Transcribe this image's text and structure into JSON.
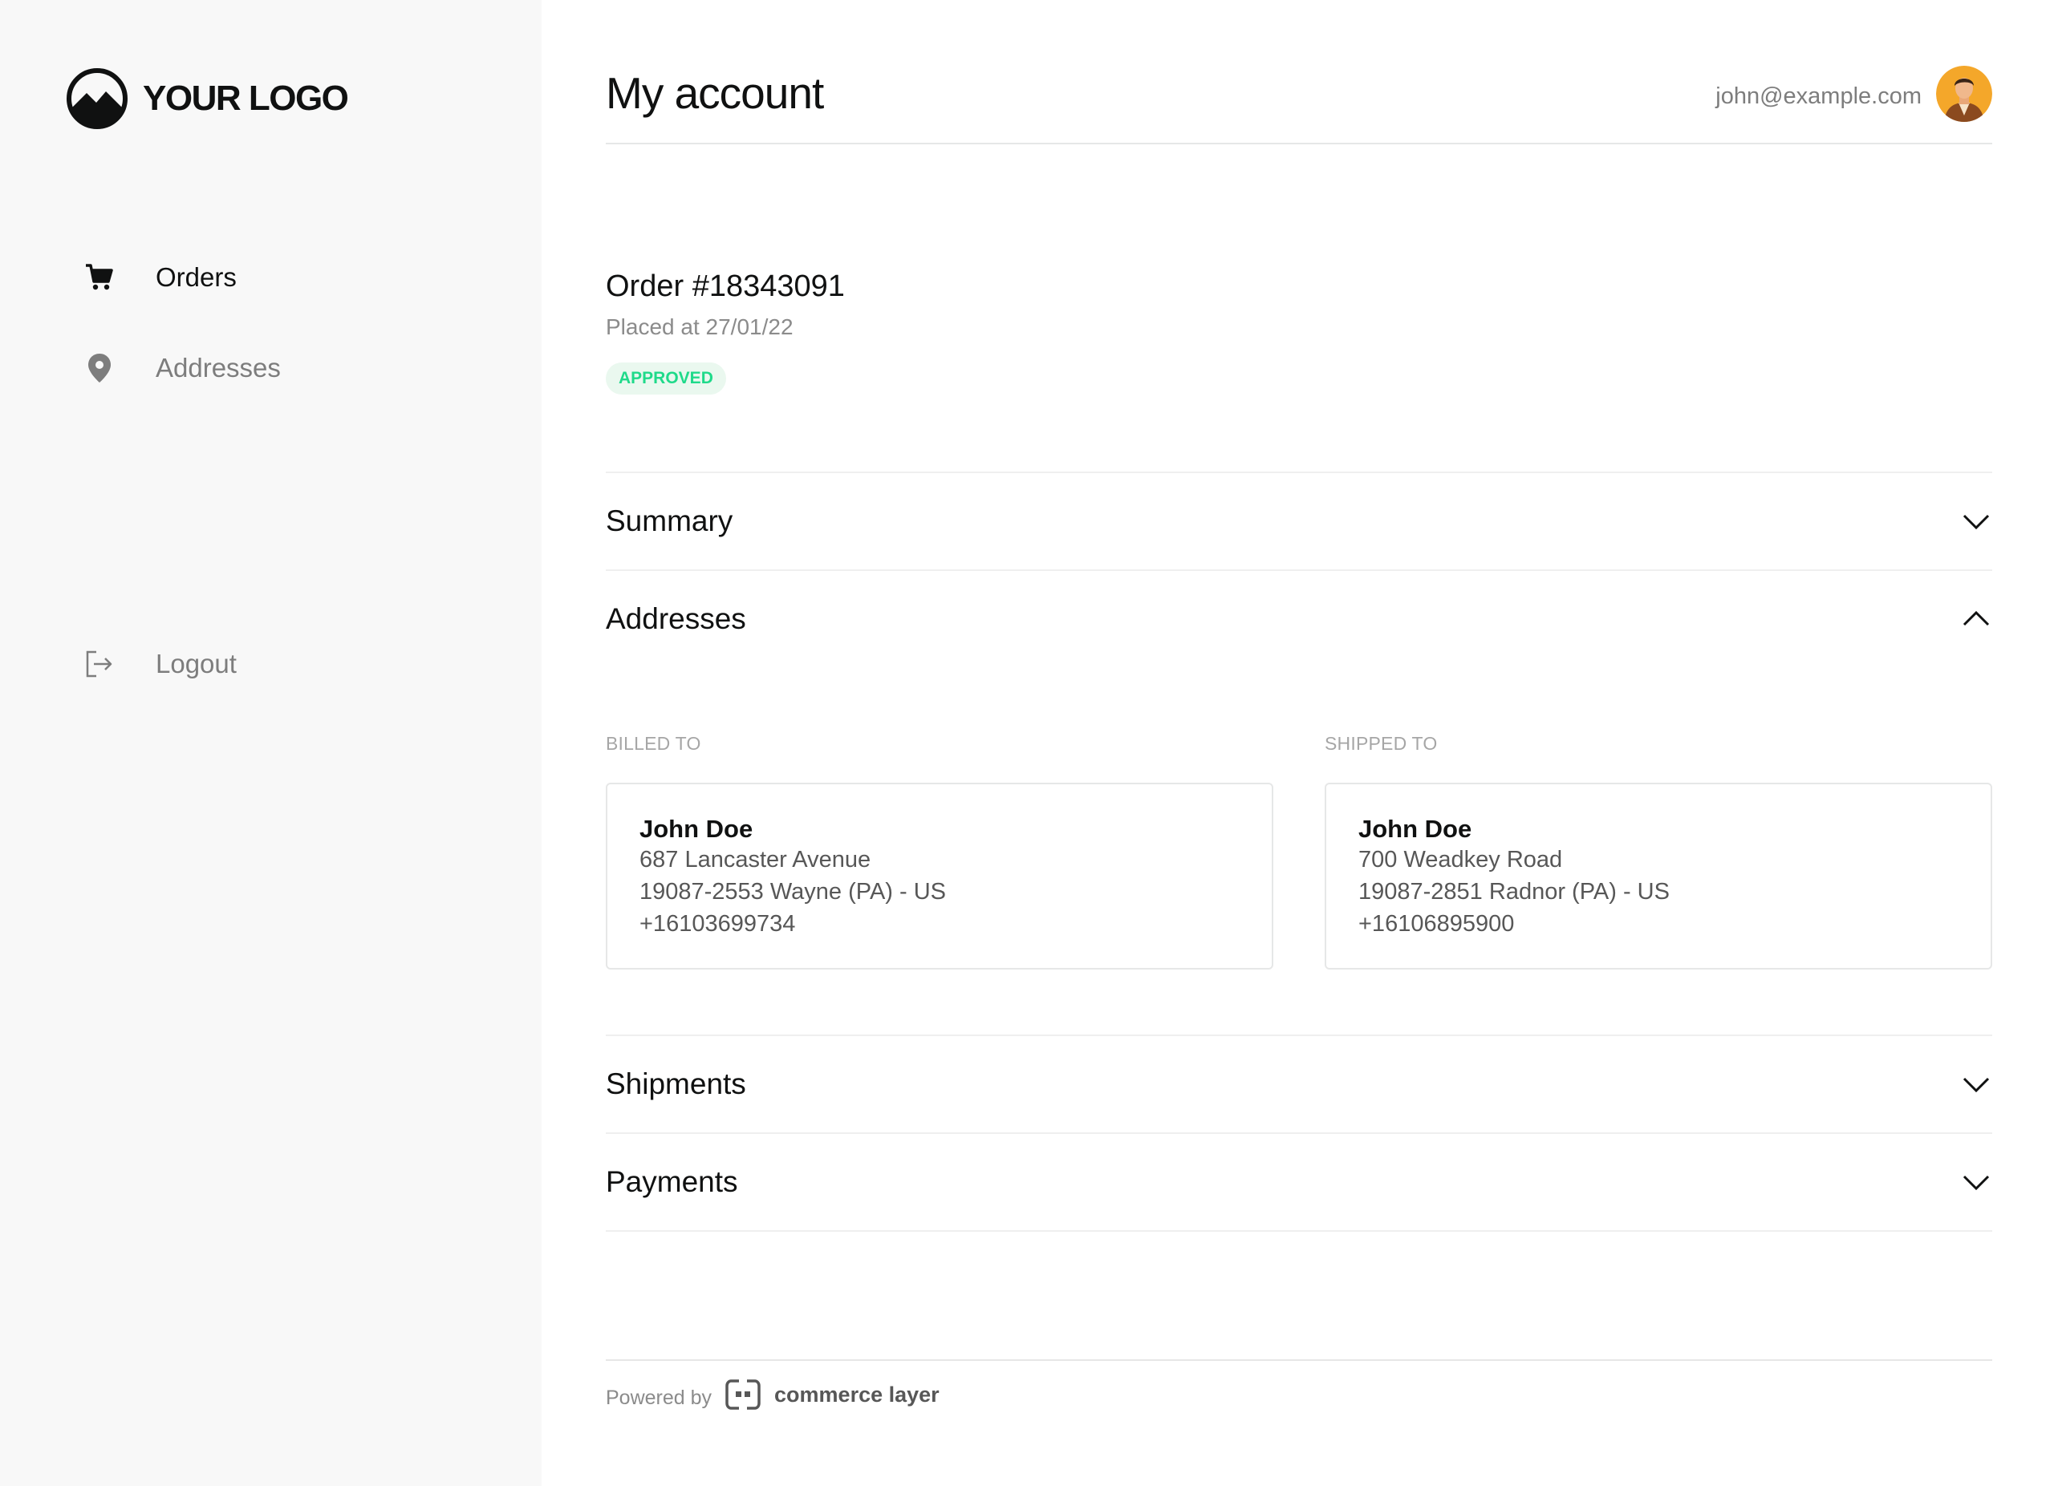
{
  "brand": {
    "logo_text": "YOUR LOGO",
    "logo_icon": "mountain-circle-icon"
  },
  "sidebar": {
    "items": [
      {
        "label": "Orders",
        "icon": "cart-icon"
      },
      {
        "label": "Addresses",
        "icon": "map-pin-icon"
      },
      {
        "label": "Logout",
        "icon": "logout-icon"
      }
    ]
  },
  "header": {
    "title": "My account",
    "user_email": "john@example.com"
  },
  "order": {
    "number": "Order #18343091",
    "placed": "Placed at 27/01/22",
    "status": "APPROVED"
  },
  "sections": {
    "summary": "Summary",
    "addresses": "Addresses",
    "shipments": "Shipments",
    "payments": "Payments"
  },
  "addresses": {
    "billed_label": "BILLED TO",
    "shipped_label": "SHIPPED TO",
    "billed": {
      "name": "John Doe",
      "line1": "687 Lancaster Avenue",
      "line2": "19087-2553 Wayne (PA) - US",
      "phone": "+16103699734"
    },
    "shipped": {
      "name": "John Doe",
      "line1": "700 Weadkey Road",
      "line2": "19087-2851 Radnor (PA) - US",
      "phone": "+16106895900"
    }
  },
  "footer": {
    "powered_by": "Powered by",
    "brand": "commerce layer"
  },
  "colors": {
    "sidebar_bg": "#f8f8f8",
    "text_primary": "#101111",
    "text_muted": "#7d7d7d",
    "badge_bg": "#eaf8ef",
    "badge_text": "#1fda8a",
    "border": "#e6e7e7"
  }
}
